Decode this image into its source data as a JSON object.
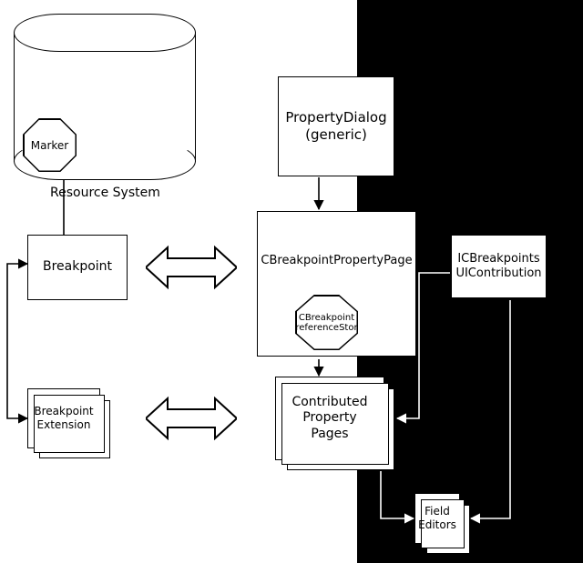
{
  "diagram": {
    "resourceSystem": {
      "label": "Resource System"
    },
    "marker": {
      "label": "Marker"
    },
    "breakpoint": {
      "label": "Breakpoint"
    },
    "breakpointExt": {
      "label": "Breakpoint\nExtension"
    },
    "propertyDialog": {
      "line1": "PropertyDialog",
      "line2": "(generic)"
    },
    "cbpPage": {
      "label": "CBreakpointPropertyPage"
    },
    "cbpStore": {
      "line1": "CBreakpoint",
      "line2": "PreferenceStore"
    },
    "contributed": {
      "line1": "Contributed",
      "line2": "Property",
      "line3": "Pages"
    },
    "fieldEditors": {
      "line1": "Field",
      "line2": "Editors"
    },
    "uicontrib": {
      "line1": "ICBreakpoints",
      "line2": "UIContribution"
    }
  },
  "chart_data": {
    "type": "diagram",
    "nodes": [
      {
        "id": "resourceSystem",
        "label": "Resource System",
        "shape": "cylinder"
      },
      {
        "id": "marker",
        "label": "Marker",
        "shape": "octagon",
        "containedIn": "resourceSystem"
      },
      {
        "id": "breakpoint",
        "label": "Breakpoint",
        "shape": "rect"
      },
      {
        "id": "breakpointExt",
        "label": "Breakpoint Extension",
        "shape": "rect-stack"
      },
      {
        "id": "propertyDialog",
        "label": "PropertyDialog (generic)",
        "shape": "rect"
      },
      {
        "id": "cbpPage",
        "label": "CBreakpointPropertyPage",
        "shape": "rect"
      },
      {
        "id": "cbpStore",
        "label": "CBreakpoint PreferenceStore",
        "shape": "octagon",
        "containedIn": "cbpPage"
      },
      {
        "id": "contributed",
        "label": "Contributed Property Pages",
        "shape": "rect-stack"
      },
      {
        "id": "fieldEditors",
        "label": "Field Editors",
        "shape": "rect-stack"
      },
      {
        "id": "uicontrib",
        "label": "ICBreakpoints UIContribution",
        "shape": "rect"
      }
    ],
    "edges": [
      {
        "from": "breakpoint",
        "to": "marker",
        "style": "arrow"
      },
      {
        "from": "breakpoint",
        "to": "breakpointExt",
        "style": "arrow-bidir-routed"
      },
      {
        "from": "breakpoint",
        "to": "cbpPage",
        "style": "fat-double-arrow"
      },
      {
        "from": "breakpointExt",
        "to": "contributed",
        "style": "fat-double-arrow"
      },
      {
        "from": "propertyDialog",
        "to": "cbpPage",
        "style": "arrow"
      },
      {
        "from": "cbpPage",
        "to": "contributed",
        "style": "arrow"
      },
      {
        "from": "contributed",
        "to": "fieldEditors",
        "style": "arrow"
      },
      {
        "from": "uicontrib",
        "to": "contributed",
        "style": "arrow"
      },
      {
        "from": "uicontrib",
        "to": "fieldEditors",
        "style": "arrow"
      }
    ]
  }
}
